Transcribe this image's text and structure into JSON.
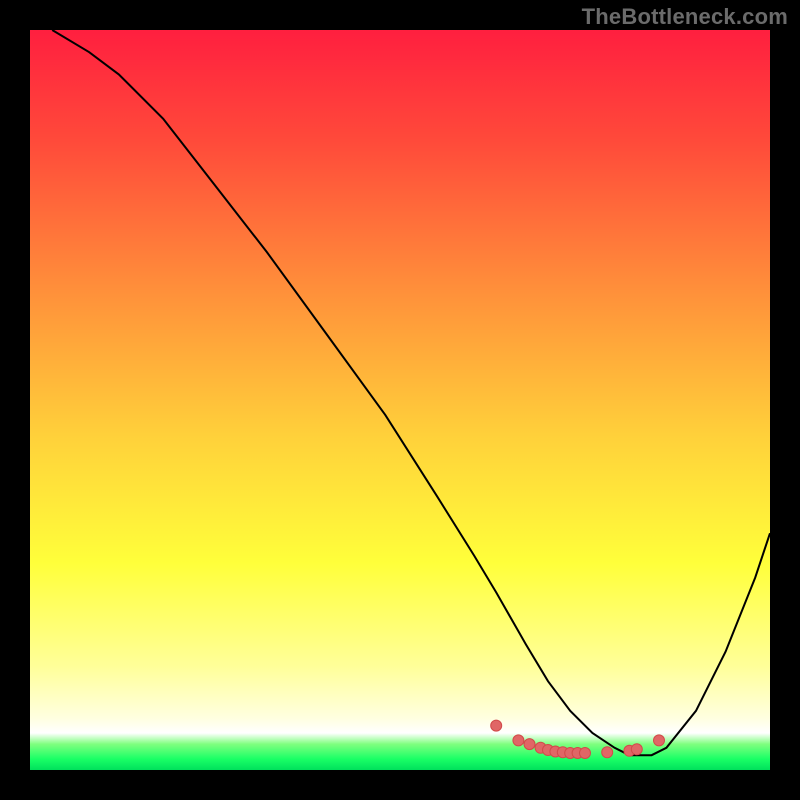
{
  "attribution": "TheBottleneck.com",
  "colors": {
    "background": "#000000",
    "attribution_text": "#6b6b6b",
    "curve": "#000000",
    "marker_fill": "#e06666",
    "marker_stroke": "#d24a4a",
    "gradient_stops": [
      {
        "offset": 0,
        "color": "#ff1f3f"
      },
      {
        "offset": 0.15,
        "color": "#ff4a3a"
      },
      {
        "offset": 0.35,
        "color": "#ff8f3a"
      },
      {
        "offset": 0.55,
        "color": "#ffd13a"
      },
      {
        "offset": 0.72,
        "color": "#ffff3a"
      },
      {
        "offset": 0.86,
        "color": "#ffff99"
      },
      {
        "offset": 0.93,
        "color": "#ffffe0"
      },
      {
        "offset": 0.95,
        "color": "#ffffff"
      },
      {
        "offset": 0.965,
        "color": "#7fff7f"
      },
      {
        "offset": 0.985,
        "color": "#1aff66"
      },
      {
        "offset": 1.0,
        "color": "#00e05c"
      }
    ]
  },
  "chart_data": {
    "type": "line",
    "title": "",
    "xlabel": "",
    "ylabel": "",
    "xlim": [
      0,
      100
    ],
    "ylim": [
      0,
      100
    ],
    "grid": false,
    "series": [
      {
        "name": "curve",
        "x": [
          3,
          8,
          12,
          18,
          25,
          32,
          40,
          48,
          55,
          60,
          63,
          67,
          70,
          73,
          76,
          79,
          81,
          84,
          86,
          90,
          94,
          98,
          100
        ],
        "y": [
          100,
          97,
          94,
          88,
          79,
          70,
          59,
          48,
          37,
          29,
          24,
          17,
          12,
          8,
          5,
          3,
          2,
          2,
          3,
          8,
          16,
          26,
          32
        ],
        "_comment": "y is the visual height above bottom edge in percent of plot height; estimated from pixels"
      }
    ],
    "markers": {
      "name": "bottom-cluster",
      "x": [
        63,
        66,
        67.5,
        69,
        70,
        71,
        72,
        73,
        74,
        75,
        78,
        81,
        82,
        85
      ],
      "y": [
        6,
        4,
        3.5,
        3.0,
        2.7,
        2.5,
        2.4,
        2.3,
        2.3,
        2.3,
        2.4,
        2.6,
        2.8,
        4
      ],
      "_comment": "cluster of small pink dots near the minimum of the curve"
    }
  }
}
